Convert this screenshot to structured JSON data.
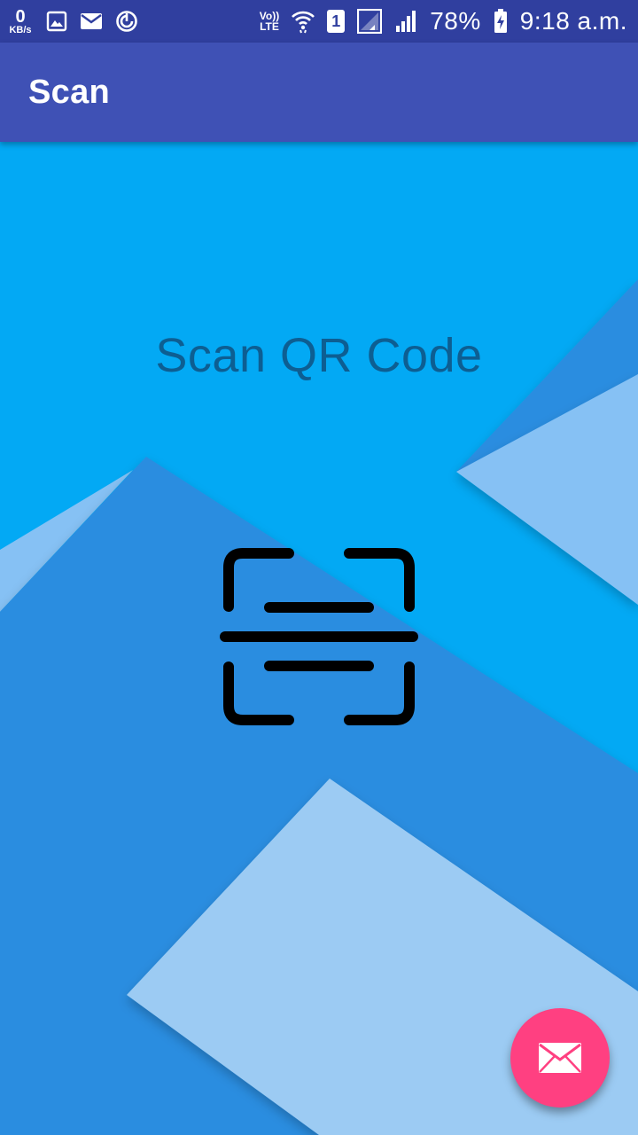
{
  "status_bar": {
    "net_speed_value": "0",
    "net_speed_unit": "KB/s",
    "volte_top": "Vo))",
    "volte_bottom": "LTE",
    "sim_slot": "1",
    "battery_percent": "78%",
    "time": "9:18 a.m.",
    "icons": [
      "image-icon",
      "mail-icon",
      "sync-icon",
      "wifi-icon",
      "signal-icon",
      "battery-charging-icon"
    ]
  },
  "app_bar": {
    "title": "Scan"
  },
  "main": {
    "heading": "Scan QR Code",
    "scan_icon": "qr-scan-icon"
  },
  "fab": {
    "icon": "mail-icon"
  },
  "colors": {
    "status_bar": "#303f9f",
    "app_bar": "#3f51b5",
    "background": "#03a9f4",
    "fab": "#ff4081",
    "heading_text": "#0d5e92"
  }
}
